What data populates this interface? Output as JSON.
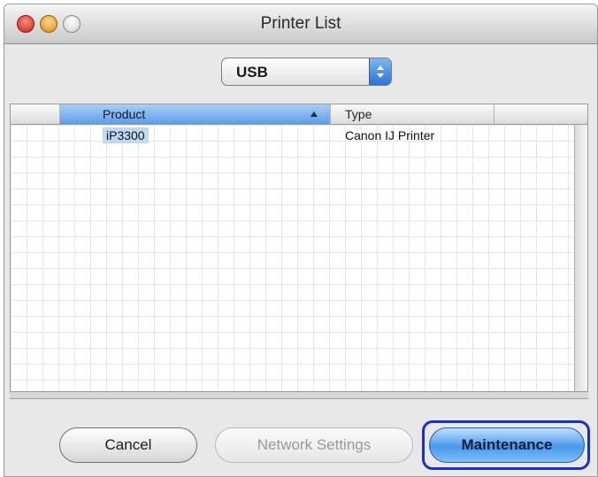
{
  "window": {
    "title": "Printer List"
  },
  "connection_popup": {
    "selected": "USB"
  },
  "printer_table": {
    "columns": [
      "Product",
      "Type"
    ],
    "sort_column": "Product",
    "sort_direction": "ascending",
    "rows": [
      {
        "product": "iP3300",
        "type": "Canon IJ Printer",
        "selected": true
      }
    ]
  },
  "buttons": {
    "cancel": "Cancel",
    "network_settings": "Network Settings",
    "maintenance": "Maintenance"
  },
  "colors": {
    "default_button": "#4b97e8",
    "highlight_outline": "#1c2fc4",
    "selection": "#c3d8f2"
  },
  "icons": [
    "close-icon",
    "minimize-icon",
    "zoom-icon",
    "popup-arrows-icon",
    "sort-ascending-icon"
  ]
}
